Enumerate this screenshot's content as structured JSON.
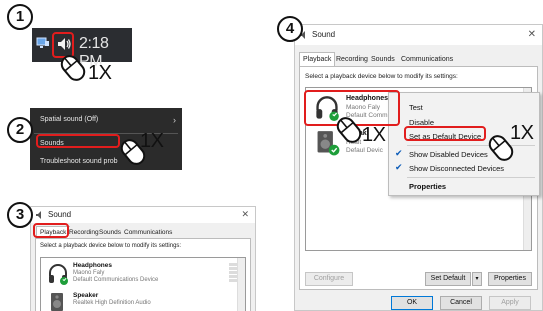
{
  "steps": [
    "1",
    "2",
    "3",
    "4"
  ],
  "click_count": "1X",
  "colors": {
    "highlight": "#e11d1d",
    "taskbar": "#2b2d31",
    "check": "#0a5bb8",
    "accent": "#0078d7"
  },
  "taskbar": {
    "clock": "2:18 PM",
    "network_icon": "network-icon",
    "speaker_icon": "speaker-icon"
  },
  "context_menu": {
    "items": [
      {
        "label": "Spatial sound (Off)",
        "chevron": "›"
      },
      {
        "label": "Sounds"
      },
      {
        "label": "Troubleshoot sound prob"
      }
    ]
  },
  "sound_dialog": {
    "title": "Sound",
    "close": "✕",
    "tabs": [
      "Playback",
      "Recording",
      "Sounds",
      "Communications"
    ],
    "instruction": "Select a playback device below to modify its settings:",
    "devices": [
      {
        "name": "Headphones",
        "line1": "Maono Faly",
        "line2": "Default Communications Device"
      },
      {
        "name": "Speaker",
        "line1": "Realtek High Definition Audio"
      }
    ]
  },
  "sound_dialog_4": {
    "title": "Sound",
    "close": "✕",
    "tabs": [
      "Playback",
      "Recording",
      "Sounds",
      "Communications"
    ],
    "instruction": "Select a playback device below to modify its settings:",
    "devices": [
      {
        "name": "Headphones",
        "line1": "Maono Faly",
        "line2": "Default Comm"
      },
      {
        "name": "Speak",
        "line1": "Realt",
        "line2": "Defaul Devic"
      }
    ],
    "buttons": {
      "configure": "Configure",
      "set_default": "Set Default",
      "properties": "Properties",
      "ok": "OK",
      "cancel": "Cancel",
      "apply": "Apply"
    },
    "menu": {
      "items": [
        {
          "label": "Test"
        },
        {
          "label": "Disable"
        },
        {
          "label": "Set as Default Device"
        },
        {
          "label": "Show Disabled Devices",
          "checked": true
        },
        {
          "label": "Show Disconnected Devices",
          "checked": true
        },
        {
          "label": "Properties",
          "bold": true
        }
      ],
      "check_glyph": "✔"
    }
  }
}
